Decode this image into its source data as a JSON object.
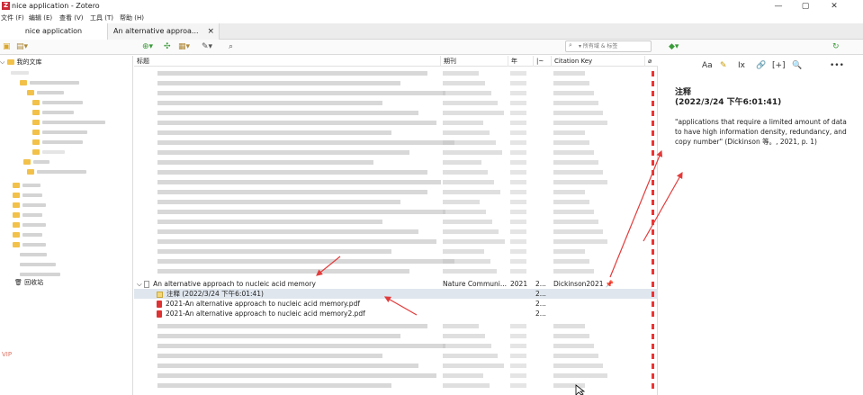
{
  "window": {
    "title": "nice application - Zotero",
    "app_icon_letter": "Z",
    "minimize": "—",
    "maximize": "▢",
    "close": "✕"
  },
  "menu": [
    "文件 (F)",
    "编辑 (E)",
    "查看 (V)",
    "工具 (T)",
    "帮助 (H)"
  ],
  "tabs": {
    "library": "nice application",
    "item": "An alternative approa...",
    "close": "×"
  },
  "toolbar": {
    "search_placeholder": "▾ 所有域 & 标签"
  },
  "left_pane": {
    "my_library": "我的文库",
    "trash": "回收站",
    "vip": "VIP"
  },
  "columns": {
    "title": "标题",
    "journal": "期刊",
    "year": "年",
    "date": "|~",
    "citation_key": "Citation Key"
  },
  "visible_items": {
    "parent": {
      "title": "An alternative approach to nucleic acid memory",
      "journal": "Nature Communi...",
      "year": "2021",
      "date": "2...",
      "citation_key": "Dickinson2021"
    },
    "children": [
      {
        "type": "note",
        "title": "注释 (2022/3/24 下午6:01:41)",
        "date": "2..."
      },
      {
        "type": "pdf",
        "title": "2021-An alternative approach to nucleic acid memory.pdf",
        "date": "2..."
      },
      {
        "type": "pdf",
        "title": "2021-An alternative approach to nucleic acid memory2.pdf",
        "date": "2..."
      }
    ]
  },
  "note": {
    "toolbar": [
      "Aa",
      "✎",
      "Ix",
      "🔗",
      "[+]",
      "🔍",
      "•••"
    ],
    "heading_line1": "注释",
    "heading_line2": "(2022/3/24 下午6:01:41)",
    "body": "\"applications that require a limited amount of data to have high information density, redundancy, and copy number\" (Dickinson 等。, 2021, p. 1)"
  },
  "colors": {
    "accent_red": "#e33b3b",
    "selected_row": "#dfe6ee",
    "folder": "#f2c14a"
  }
}
